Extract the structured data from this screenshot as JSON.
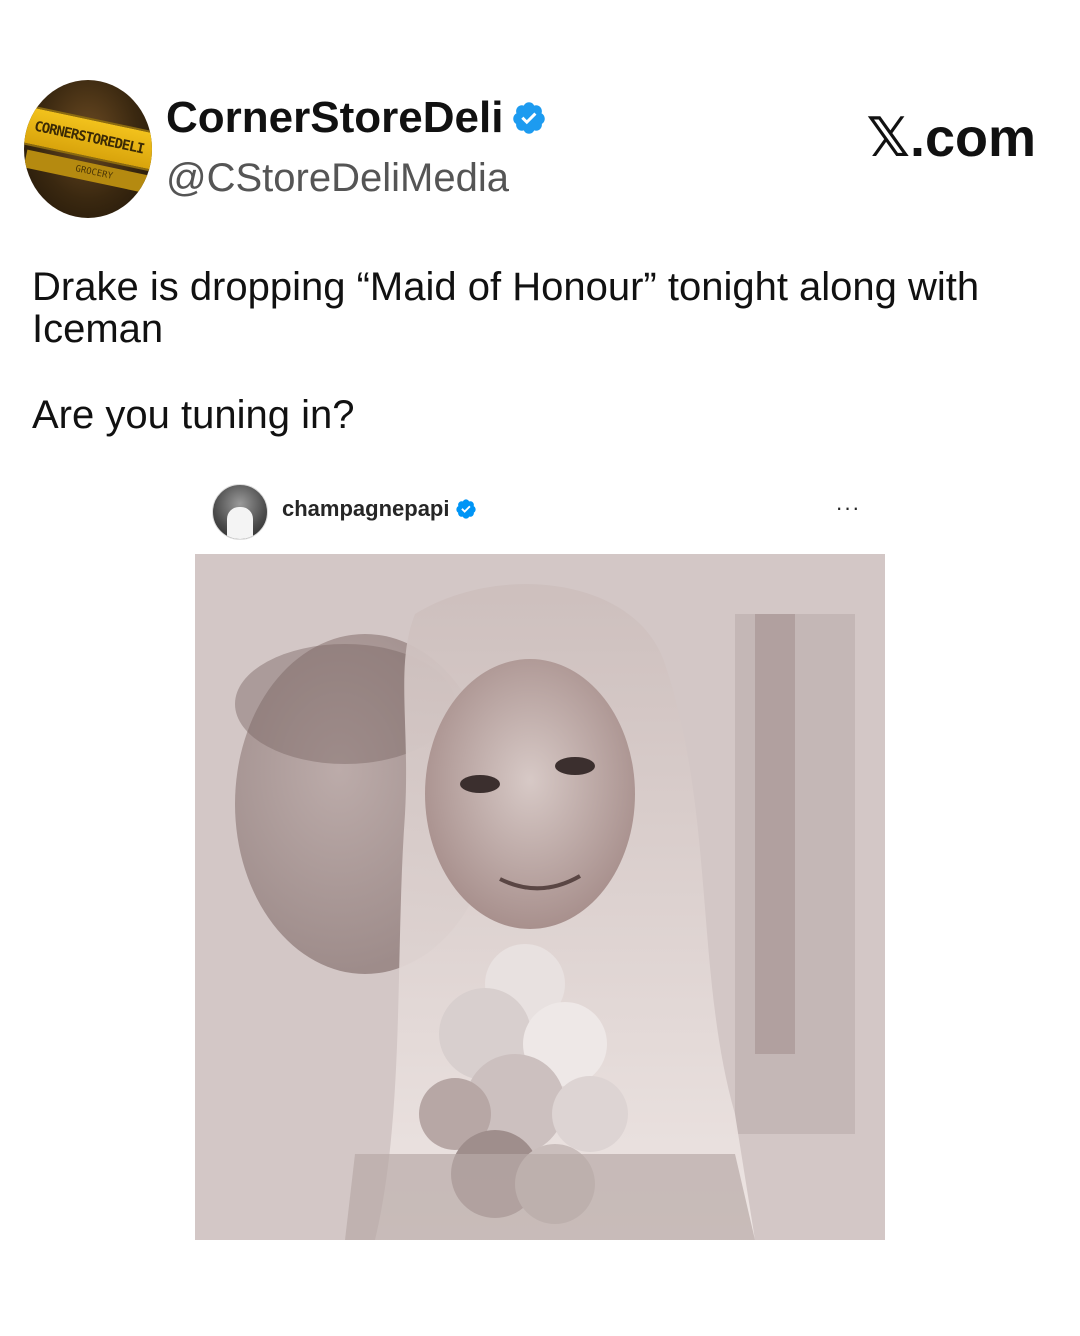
{
  "header": {
    "display_name": "CornerStoreDeli",
    "handle": "@CStoreDeliMedia",
    "site_label": "𝕏.com",
    "avatar_sign_text": "CORNERSTOREDELI",
    "avatar_sign_subtext": "GROCERY",
    "verified_color": "#1d9bf0"
  },
  "tweet": {
    "lines": [
      "Drake is dropping “Maid of Honour” tonight along with",
      "Iceman",
      "Are you tuning in?"
    ]
  },
  "embedded_post": {
    "username": "champagnepapi",
    "more_icon": "more-horizontal-icon",
    "more_label": "···",
    "verified_color": "#0095f6"
  }
}
